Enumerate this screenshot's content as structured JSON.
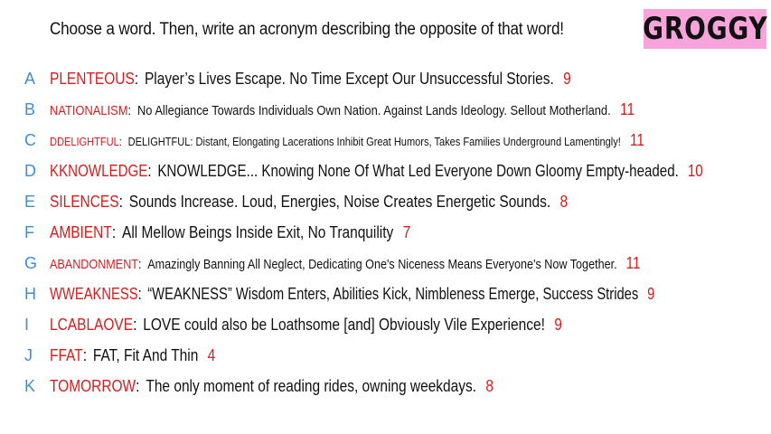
{
  "prompt": "Choose a word. Then, write an acronym describing the opposite of that word!",
  "badge": "GROGGY",
  "colors": {
    "letter": "#3a8fd6",
    "word": "#dd1a1a",
    "badge_bg": "#f7a3dc"
  },
  "entries": [
    {
      "letter": "A",
      "word": "PLENTEOUS",
      "acronym": "Player’s Lives Escape. No Time Except Our Unsuccessful Stories.",
      "count": "9"
    },
    {
      "letter": "B",
      "word": "NATIONALISM",
      "acronym": "No Allegiance Towards Individuals Own Nation. Against Lands Ideology. Sellout Motherland.",
      "count": "11"
    },
    {
      "letter": "C",
      "word": "DDELIGHTFUL",
      "acronym": "DELIGHTFUL: Distant, Elongating Lacerations Inhibit Great Humors, Takes Families Underground Lamentingly!",
      "count": "11"
    },
    {
      "letter": "D",
      "word": "KKNOWLEDGE",
      "acronym": "KNOWLEDGE... Knowing None Of What Led Everyone Down Gloomy Empty-headed.",
      "count": "10"
    },
    {
      "letter": "E",
      "word": "SILENCES",
      "acronym": "Sounds Increase. Loud, Energies, Noise Creates Energetic Sounds.",
      "count": "8"
    },
    {
      "letter": "F",
      "word": "AMBIENT",
      "acronym": "All Mellow Beings Inside Exit, No Tranquility",
      "count": "7"
    },
    {
      "letter": "G",
      "word": "ABANDONMENT",
      "acronym": "Amazingly Banning All Neglect, Dedicating One's Niceness Means Everyone's Now Together.",
      "count": "11"
    },
    {
      "letter": "H",
      "word": "WWEAKNESS",
      "acronym": "“WEAKNESS” Wisdom Enters, Abilities Kick, Nimbleness Emerge, Success Strides",
      "count": "9"
    },
    {
      "letter": "I",
      "word": "LCABLAOVE",
      "acronym": "LOVE could also be Loathsome [and] Obviously Vile Experience!",
      "count": "9"
    },
    {
      "letter": "J",
      "word": "FFAT",
      "acronym": "FAT, Fit And Thin",
      "count": "4"
    },
    {
      "letter": "K",
      "word": "TOMORROW",
      "acronym": "The only moment of reading rides, owning weekdays.",
      "count": "8"
    }
  ]
}
